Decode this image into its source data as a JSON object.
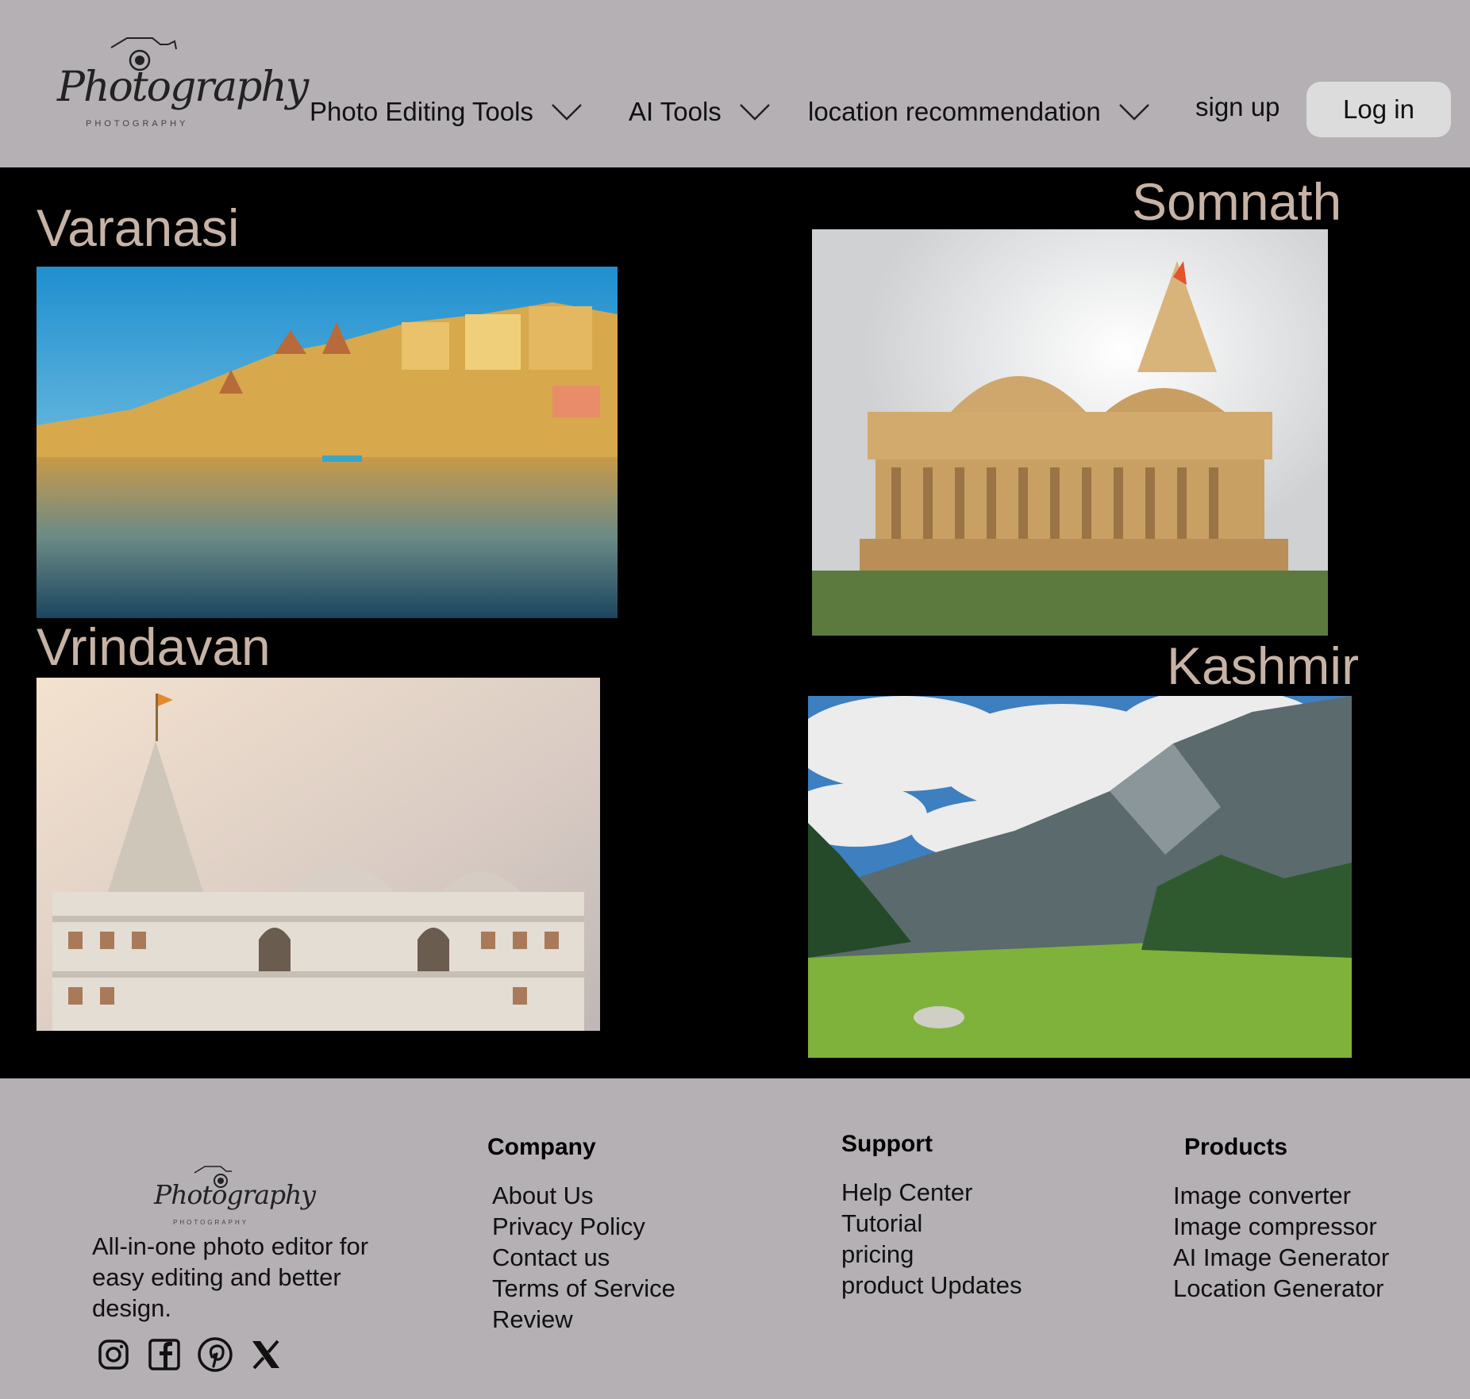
{
  "header": {
    "logo": {
      "text": "Photography",
      "subtext": "PHOTOGRAPHY"
    },
    "nav": [
      {
        "label": "Photo Editing Tools",
        "icon": "chevron-down-icon"
      },
      {
        "label": "AI Tools",
        "icon": "chevron-down-icon"
      },
      {
        "label": "location recommendation",
        "icon": "chevron-down-icon"
      }
    ],
    "signup_label": "sign up",
    "login_label": "Log in"
  },
  "places": [
    {
      "name": "Varanasi",
      "image": "varanasi-ghats-photo"
    },
    {
      "name": "Somnath",
      "image": "somnath-temple-photo"
    },
    {
      "name": "Vrindavan",
      "image": "vrindavan-prem-mandir-photo"
    },
    {
      "name": "Kashmir",
      "image": "kashmir-valley-photo"
    }
  ],
  "footer": {
    "logo": {
      "text": "Photography",
      "subtext": "PHOTOGRAPHY"
    },
    "tagline": "All-in-one photo editor for easy editing and better design.",
    "socials": [
      "instagram-icon",
      "facebook-icon",
      "pinterest-icon",
      "x-icon"
    ],
    "columns": [
      {
        "heading": "Company",
        "items": [
          "About Us",
          "Privacy Policy",
          "Contact us",
          "Terms of Service",
          "Review"
        ]
      },
      {
        "heading": "Support",
        "items": [
          "Help Center",
          "Tutorial",
          "pricing",
          "product Updates"
        ]
      },
      {
        "heading": "Products",
        "items": [
          "Image converter",
          "Image compressor",
          "AI Image Generator",
          "Location Generator"
        ]
      }
    ]
  },
  "colors": {
    "header_bg": "#b4b0b3",
    "main_bg": "#000000",
    "title_color": "#c7b3a6",
    "login_bg": "#dcdcdd"
  }
}
